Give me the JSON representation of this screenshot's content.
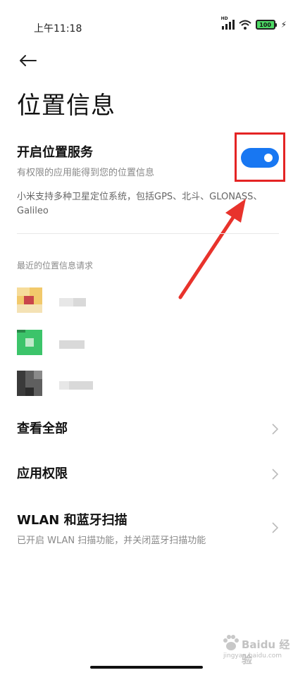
{
  "status_bar": {
    "time": "上午11:18",
    "network_tag": "HD",
    "battery_level": "100",
    "battery_color": "#4cd964"
  },
  "header": {
    "back_icon": "arrow-left-icon",
    "title": "位置信息"
  },
  "location_service": {
    "title": "开启位置服务",
    "subtitle": "有权限的应用能得到您的位置信息",
    "enabled": true,
    "switch_color": "#1877f2",
    "highlight_color": "#e42424",
    "note": "小米支持多种卫星定位系统，包括GPS、北斗、GLONASS、Galileo"
  },
  "recent_requests": {
    "header": "最近的位置信息请求",
    "apps": [
      {
        "icon": "blurred-app-icon"
      },
      {
        "icon": "blurred-app-icon"
      },
      {
        "icon": "blurred-app-icon"
      }
    ]
  },
  "menu": [
    {
      "title": "查看全部",
      "subtitle": "",
      "icon": "chevron-right-icon"
    },
    {
      "title": "应用权限",
      "subtitle": "",
      "icon": "chevron-right-icon"
    },
    {
      "title": "WLAN 和蓝牙扫描",
      "subtitle": "已开启 WLAN 扫描功能，并关闭蓝牙扫描功能",
      "icon": "chevron-right-icon"
    }
  ],
  "watermark": {
    "brand": "Baidu 经验",
    "url": "jingyan.baidu.com"
  }
}
